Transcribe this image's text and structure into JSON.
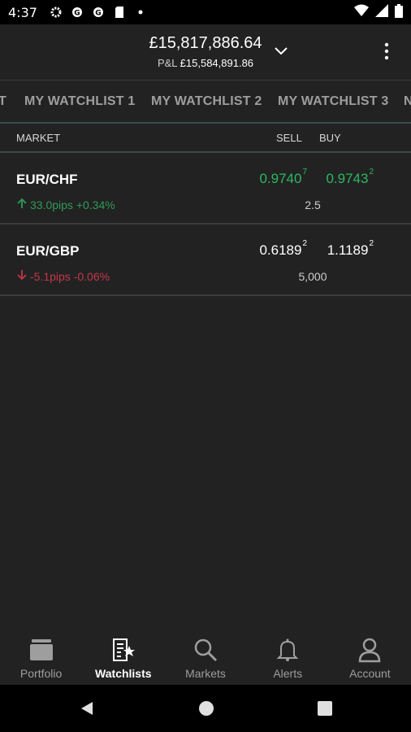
{
  "status_bar": {
    "time": "4:37",
    "left_icons": [
      "settings-icon",
      "data-saver-icon",
      "data-saver-icon",
      "sim-card-icon",
      "notification-dot-icon"
    ],
    "right_icons": [
      "wifi-icon",
      "signal-icon",
      "battery-icon"
    ]
  },
  "header": {
    "balance": "£15,817,886.64",
    "pnl_label": "P&L",
    "pnl_value": "£15,584,891.86"
  },
  "tabs": [
    {
      "label": "T"
    },
    {
      "label": "MY WATCHLIST 1"
    },
    {
      "label": "MY WATCHLIST 2"
    },
    {
      "label": "MY WATCHLIST 3"
    },
    {
      "label": "N"
    }
  ],
  "columns": {
    "market": "MARKET",
    "sell": "SELL",
    "buy": "BUY"
  },
  "rows": [
    {
      "name": "EUR/CHF",
      "direction": "up",
      "change": "33.0pips +0.34%",
      "sell_main": "0.9740",
      "sell_sup": "7",
      "buy_main": "0.9743",
      "buy_sup": "2",
      "spread": "2.5",
      "price_color": "#2db863",
      "change_color": "#2e9b57"
    },
    {
      "name": "EUR/GBP",
      "direction": "down",
      "change": "-5.1pips -0.06%",
      "sell_main": "0.6189",
      "sell_sup": "2",
      "buy_main": "1.1189",
      "buy_sup": "2",
      "spread": "5,000",
      "price_color": "#ffffff",
      "change_color": "#c2374a"
    }
  ],
  "bottom_nav": [
    {
      "label": "Portfolio",
      "icon": "portfolio-icon",
      "active": false
    },
    {
      "label": "Watchlists",
      "icon": "watchlist-icon",
      "active": true
    },
    {
      "label": "Markets",
      "icon": "search-icon",
      "active": false
    },
    {
      "label": "Alerts",
      "icon": "bell-icon",
      "active": false
    },
    {
      "label": "Account",
      "icon": "account-icon",
      "active": false
    }
  ],
  "colors": {
    "background": "#222222",
    "positive": "#2db863",
    "negative": "#c2374a",
    "inactive": "#9e9e9e"
  }
}
